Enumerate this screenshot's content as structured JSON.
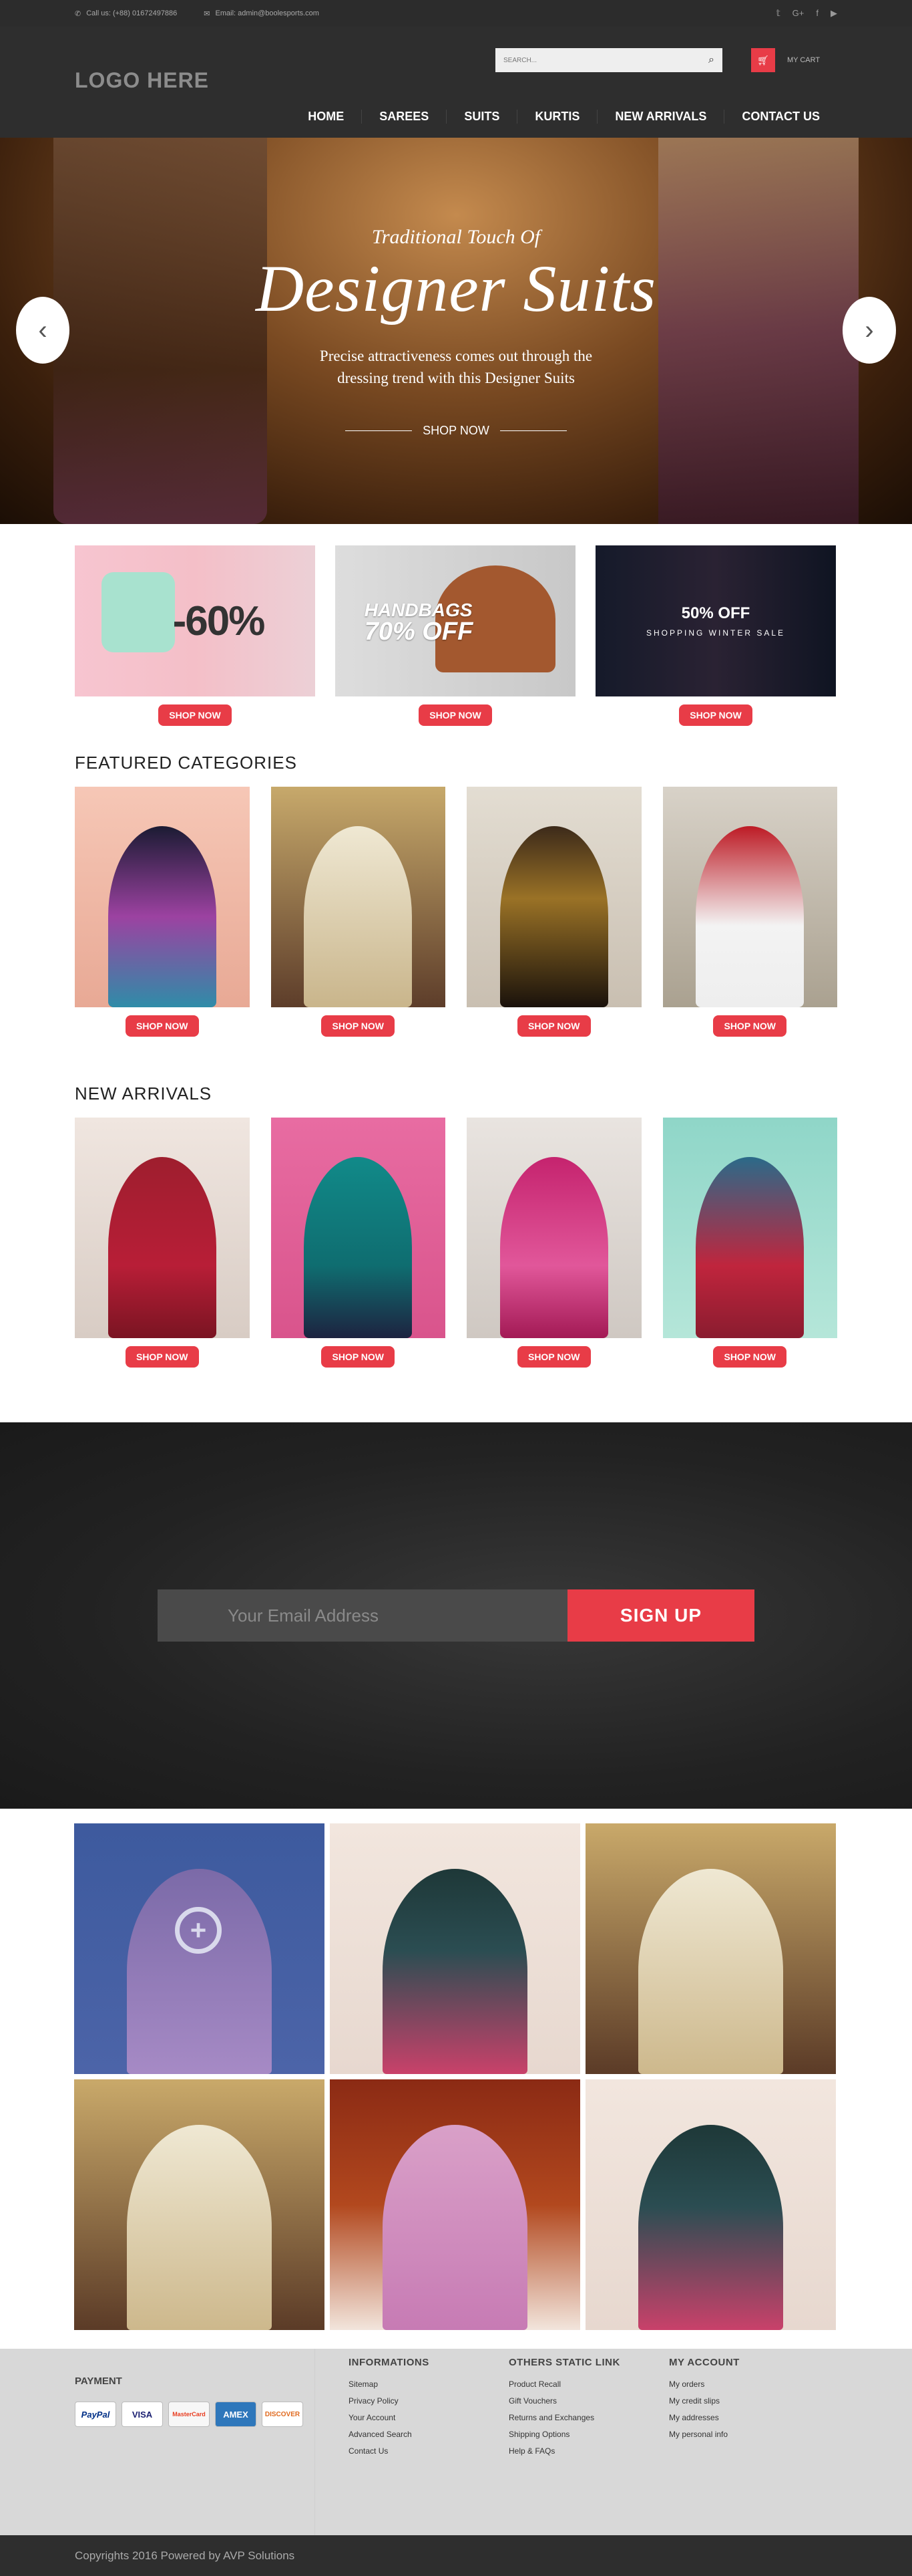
{
  "topbar": {
    "phone": "Call us: (+88) 01672497886",
    "email": "Email: admin@boolesports.com",
    "social": [
      "twitter-icon",
      "google-plus-icon",
      "facebook-icon",
      "youtube-icon"
    ]
  },
  "header": {
    "logo": "LOGO HERE",
    "search_placeholder": "SEARCH...",
    "cart_label": "MY CART",
    "nav": [
      "HOME",
      "SAREES",
      "SUITS",
      "KURTIS",
      "NEW ARRIVALS",
      "CONTACT US"
    ]
  },
  "hero": {
    "kicker": "Traditional Touch Of",
    "title": "Designer Suits",
    "desc_line1": "Precise attractiveness comes out through the",
    "desc_line2": "dressing trend with this Designer Suits",
    "cta": "SHOP NOW"
  },
  "promos": [
    {
      "text": "-60%",
      "button": "SHOP NOW"
    },
    {
      "line1": "HANDBAGS",
      "line2": "70% OFF",
      "button": "SHOP NOW"
    },
    {
      "line1": "50% OFF",
      "line2": "SHOPPING WINTER SALE",
      "button": "SHOP NOW"
    }
  ],
  "featured": {
    "title": "FEATURED  CATEGORIES",
    "items": [
      {
        "button": "SHOP NOW"
      },
      {
        "button": "SHOP NOW"
      },
      {
        "button": "SHOP NOW"
      },
      {
        "button": "SHOP NOW"
      }
    ]
  },
  "new_arrivals": {
    "title": "NEW ARRIVALS",
    "items": [
      {
        "button": "SHOP NOW"
      },
      {
        "button": "SHOP NOW"
      },
      {
        "button": "SHOP NOW"
      },
      {
        "button": "SHOP NOW"
      }
    ]
  },
  "newsletter": {
    "placeholder": "Your Email Address",
    "button": "SIGN UP"
  },
  "footer": {
    "payment_title": "PAYMENT",
    "cards": [
      "PayPal",
      "VISA",
      "MasterCard",
      "AMEX",
      "DISCOVER"
    ],
    "columns": [
      {
        "title": "INFORMATIONS",
        "links": [
          "Sitemap",
          "Privacy Policy",
          "Your Account",
          "Advanced Search",
          "Contact Us"
        ]
      },
      {
        "title": "OTHERS STATIC LINK",
        "links": [
          "Product Recall",
          "Gift Vouchers",
          "Returns and Exchanges",
          "Shipping Options",
          "Help & FAQs"
        ]
      },
      {
        "title": "MY ACCOUNT",
        "links": [
          "My orders",
          "My credit slips",
          "My addresses",
          "My personal info"
        ]
      }
    ],
    "copyright": "Copyrights 2016 Powered by AVP Solutions"
  },
  "colors": {
    "accent": "#e83c47",
    "dark": "#2e2e2e",
    "footer_bg": "#d8d8d8"
  }
}
